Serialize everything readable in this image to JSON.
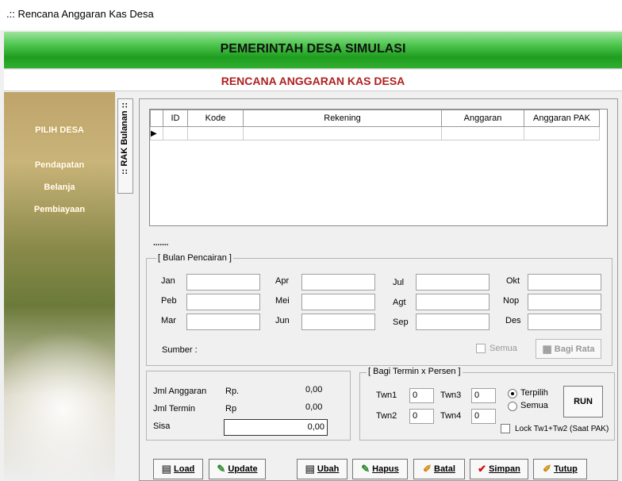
{
  "window": {
    "title": ".:: Rencana Anggaran Kas Desa"
  },
  "header": {
    "title": "PEMERINTAH DESA SIMULASI",
    "subtitle": "RENCANA ANGGARAN KAS DESA"
  },
  "sidebar": {
    "items": [
      "PILIH DESA",
      "Pendapatan",
      "Belanja",
      "Pembiayaan"
    ]
  },
  "tab": {
    "label": ":: RAK Bulanan ::"
  },
  "grid": {
    "columns": [
      "ID",
      "Kode",
      "Rekening",
      "Anggaran",
      "Anggaran PAK"
    ],
    "row_marker": "▶"
  },
  "dots": ".......",
  "bulan": {
    "legend": "[ Bulan Pencairan ]",
    "months": [
      "Jan",
      "Peb",
      "Mar",
      "Apr",
      "Mei",
      "Jun",
      "Jul",
      "Agt",
      "Sep",
      "Okt",
      "Nop",
      "Des"
    ],
    "sumber": "Sumber :",
    "semua": "Semua",
    "bagi_rata": "Bagi Rata"
  },
  "summary": {
    "jml_anggaran": "Jml Anggaran",
    "rp1": "Rp.",
    "val1": "0,00",
    "jml_termin": "Jml Termin",
    "rp2": "Rp",
    "val2": "0,00",
    "sisa": "Sisa",
    "val3": "0,00"
  },
  "termin": {
    "legend": "[ Bagi Termin x Persen ]",
    "twn1": "Twn1",
    "twn2": "Twn2",
    "twn3": "Twn3",
    "twn4": "Twn4",
    "v1": "0",
    "v2": "0",
    "v3": "0",
    "v4": "0",
    "terpilih": "Terpilih",
    "semua": "Semua",
    "run": "RUN",
    "lock": "Lock Tw1+Tw2 (Saat PAK)"
  },
  "buttons": {
    "load": "Load",
    "update": "Update",
    "ubah": "Ubah",
    "hapus": "Hapus",
    "batal": "Batal",
    "simpan": "Simpan",
    "tutup": "Tutup"
  }
}
